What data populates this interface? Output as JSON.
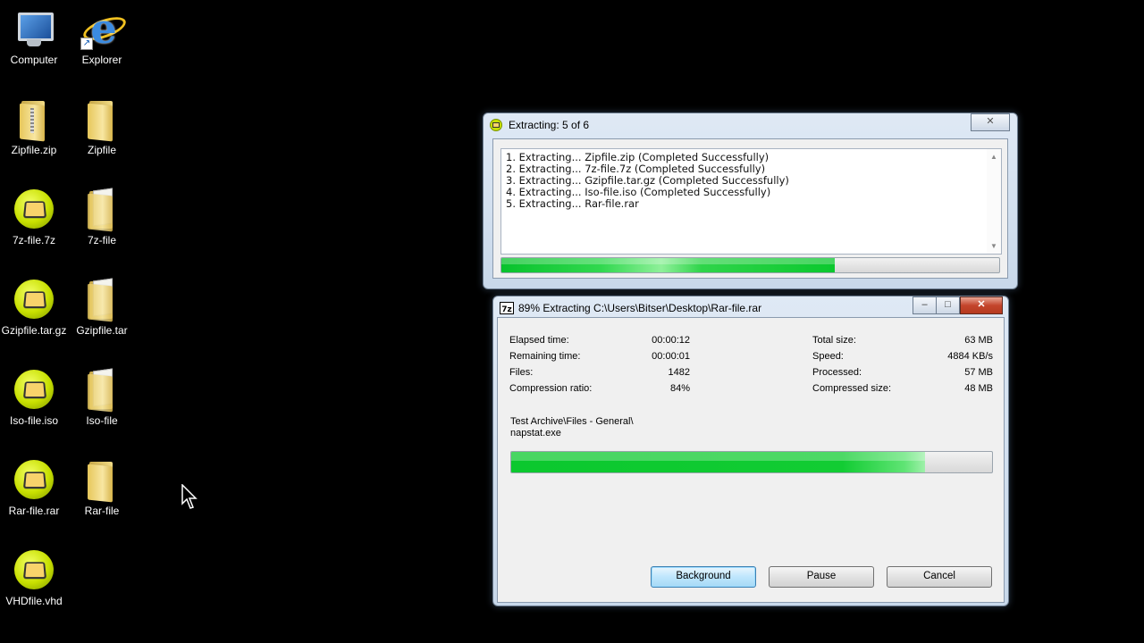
{
  "desktop": {
    "icons": [
      {
        "label": "Computer",
        "icon": "computer-icon"
      },
      {
        "label": "Explorer",
        "icon": "internet-explorer-icon"
      },
      {
        "label": "Zipfile.zip",
        "icon": "zip-folder-icon"
      },
      {
        "label": "Zipfile",
        "icon": "folder-icon"
      },
      {
        "label": "7z-file.7z",
        "icon": "archive-app-icon"
      },
      {
        "label": "7z-file",
        "icon": "folder-icon"
      },
      {
        "label": "Gzipfile.tar.gz",
        "icon": "archive-app-icon"
      },
      {
        "label": "Gzipfile.tar",
        "icon": "folder-icon"
      },
      {
        "label": "Iso-file.iso",
        "icon": "archive-app-icon"
      },
      {
        "label": "Iso-file",
        "icon": "folder-icon"
      },
      {
        "label": "Rar-file.rar",
        "icon": "archive-app-icon"
      },
      {
        "label": "Rar-file",
        "icon": "folder-icon"
      },
      {
        "label": "VHDfile.vhd",
        "icon": "archive-app-icon"
      }
    ]
  },
  "batch_window": {
    "title": "Extracting: 5 of 6",
    "log": [
      "1. Extracting... Zipfile.zip (Completed Successfully)",
      "2. Extracting... 7z-file.7z (Completed Successfully)",
      "3. Extracting... Gzipfile.tar.gz (Completed Successfully)",
      "4. Extracting... Iso-file.iso (Completed Successfully)",
      "5. Extracting... Rar-file.rar"
    ],
    "progress_fraction": 0.67
  },
  "sevenzip_window": {
    "title": "89% Extracting C:\\Users\\Bitser\\Desktop\\Rar-file.rar",
    "left_stats": [
      {
        "label": "Elapsed time:",
        "value": "00:00:12"
      },
      {
        "label": "Remaining time:",
        "value": "00:00:01"
      },
      {
        "label": "Files:",
        "value": "1482"
      },
      {
        "label": "Compression ratio:",
        "value": "84%"
      }
    ],
    "right_stats": [
      {
        "label": "Total size:",
        "value": "63 MB"
      },
      {
        "label": "Speed:",
        "value": "4884 KB/s"
      },
      {
        "label": "Processed:",
        "value": "57 MB"
      },
      {
        "label": "Compressed size:",
        "value": "48 MB"
      }
    ],
    "current_path": "Test Archive\\Files - General\\",
    "current_file": "napstat.exe",
    "progress_fraction": 0.86,
    "buttons": {
      "background": "Background",
      "pause": "Pause",
      "cancel": "Cancel"
    }
  },
  "colors": {
    "progress_green": "#0bc82e",
    "desktop_bg": "#000000"
  }
}
